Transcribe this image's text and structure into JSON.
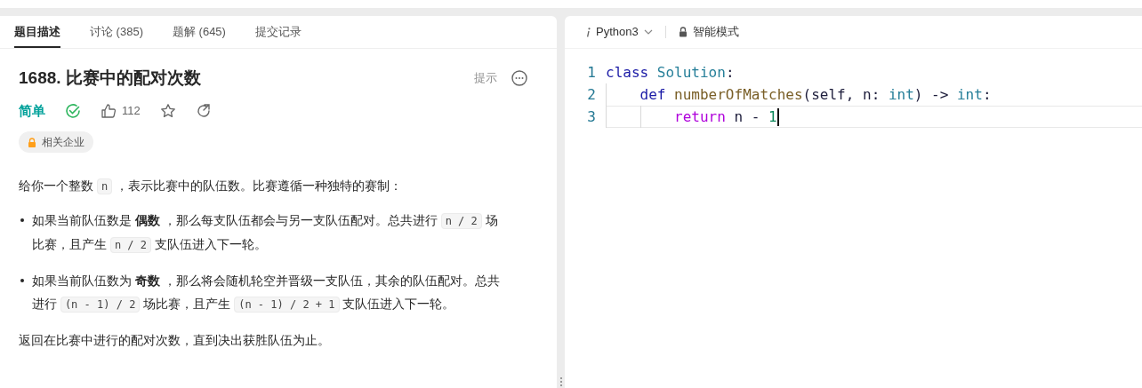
{
  "tabs": [
    {
      "label": "题目描述",
      "selected": true
    },
    {
      "label": "讨论 (385)",
      "selected": false
    },
    {
      "label": "题解 (645)",
      "selected": false
    },
    {
      "label": "提交记录",
      "selected": false
    }
  ],
  "problem": {
    "title": "1688. 比赛中的配对次数",
    "hint_button": "提示",
    "difficulty": "简单",
    "solved": true,
    "likes": "112",
    "tag": "相关企业"
  },
  "description": [
    {
      "kind": "para",
      "segments": [
        {
          "kind": "text",
          "text": "给你一个整数 "
        },
        {
          "kind": "code",
          "text": "n"
        },
        {
          "kind": "text",
          "text": " ，表示比赛中的队伍数。比赛遵循一种独特的赛制："
        }
      ]
    },
    {
      "kind": "bullet",
      "segments": [
        {
          "kind": "text",
          "text": "如果当前队伍数是 "
        },
        {
          "kind": "bold",
          "text": "偶数"
        },
        {
          "kind": "text",
          "text": " ，那么每支队伍都会与另一支队伍配对。总共进行 "
        },
        {
          "kind": "code",
          "text": "n / 2"
        },
        {
          "kind": "text",
          "text": " 场比赛，且产生 "
        },
        {
          "kind": "code",
          "text": "n / 2"
        },
        {
          "kind": "text",
          "text": " 支队伍进入下一轮。"
        }
      ]
    },
    {
      "kind": "bullet",
      "segments": [
        {
          "kind": "text",
          "text": "如果当前队伍数为 "
        },
        {
          "kind": "bold",
          "text": "奇数"
        },
        {
          "kind": "text",
          "text": " ，那么将会随机轮空并晋级一支队伍，其余的队伍配对。总共进行 "
        },
        {
          "kind": "code",
          "text": "(n - 1) / 2"
        },
        {
          "kind": "text",
          "text": " 场比赛，且产生 "
        },
        {
          "kind": "code",
          "text": "(n - 1) / 2 + 1"
        },
        {
          "kind": "text",
          "text": " 支队伍进入下一轮。"
        }
      ]
    },
    {
      "kind": "para",
      "segments": [
        {
          "kind": "text",
          "text": "返回在比赛中进行的配对次数，直到决出获胜队伍为止。"
        }
      ]
    }
  ],
  "editor": {
    "language": "Python3",
    "mode": "智能模式",
    "lines": [
      {
        "number": "1",
        "current": false,
        "tokens": [
          {
            "kind": "keyword",
            "text": "class"
          },
          {
            "kind": "class",
            "text": " Solution"
          },
          {
            "kind": "plain",
            "text": ":"
          }
        ]
      },
      {
        "number": "2",
        "current": false,
        "tokens": [
          {
            "kind": "indent"
          },
          {
            "kind": "keyword",
            "text": "def"
          },
          {
            "kind": "func",
            "text": " numberOfMatches"
          },
          {
            "kind": "plain",
            "text": "(self, n: "
          },
          {
            "kind": "type",
            "text": "int"
          },
          {
            "kind": "plain",
            "text": ") -> "
          },
          {
            "kind": "type",
            "text": "int"
          },
          {
            "kind": "plain",
            "text": ":"
          }
        ]
      },
      {
        "number": "3",
        "current": true,
        "tokens": [
          {
            "kind": "indent"
          },
          {
            "kind": "indent"
          },
          {
            "kind": "control",
            "text": "return"
          },
          {
            "kind": "plain",
            "text": " n - "
          },
          {
            "kind": "number",
            "text": "1"
          }
        ]
      }
    ]
  }
}
